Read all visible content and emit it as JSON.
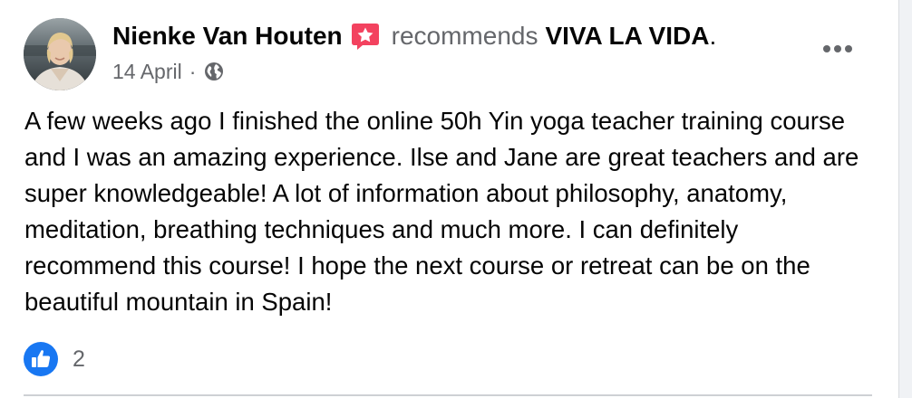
{
  "post": {
    "author": "Nienke Van Houten",
    "action": "recommends",
    "page": "VIVA LA VIDA",
    "punctuation": ".",
    "date": "14 April",
    "separator": "·",
    "visibility_icon": "globe-icon",
    "body": "A few weeks ago I finished the online 50h Yin yoga teacher training course and I was an amazing experience. Ilse and Jane are great teachers and are super knowledgeable! A lot of information about philosophy, anatomy, meditation, breathing techniques and much more. I can definitely recommend this course! I hope the next course or retreat can be on the beautiful mountain in Spain!",
    "reaction_icon": "like-icon",
    "reaction_count": "2",
    "menu_icon": "more-options-icon"
  },
  "colors": {
    "recommend_badge": "#f3425f",
    "like_blue": "#1877f2",
    "secondary_text": "#65676b",
    "primary_text": "#050505"
  }
}
